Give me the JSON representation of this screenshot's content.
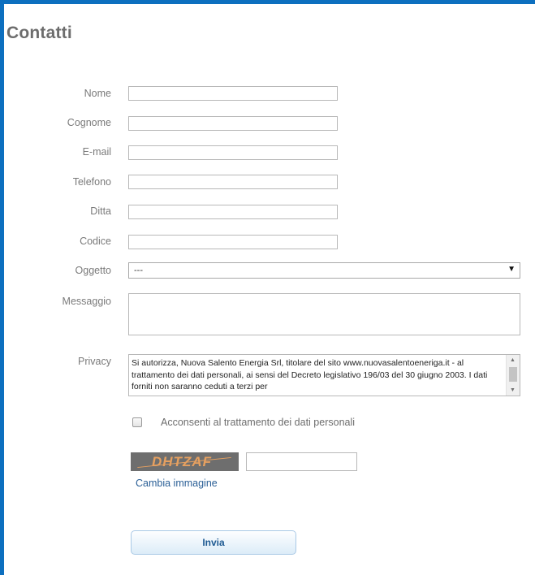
{
  "page": {
    "title": "Contatti"
  },
  "form": {
    "fields": [
      {
        "label": "Nome",
        "value": ""
      },
      {
        "label": "Cognome",
        "value": ""
      },
      {
        "label": "E-mail",
        "value": ""
      },
      {
        "label": "Telefono",
        "value": ""
      },
      {
        "label": "Ditta",
        "value": ""
      },
      {
        "label": "Codice",
        "value": ""
      }
    ],
    "oggetto": {
      "label": "Oggetto",
      "selected": "---"
    },
    "messaggio": {
      "label": "Messaggio",
      "value": ""
    },
    "privacy": {
      "label": "Privacy",
      "text": "Si autorizza, Nuova Salento Energia Srl, titolare del sito www.nuovasalentoeneriga.it - al trattamento dei dati personali, ai sensi del Decreto legislativo 196/03 del 30 giugno 2003. I dati forniti non saranno ceduti a terzi per"
    },
    "consent": {
      "label": "Acconsenti al trattamento dei dati personali",
      "checked": false
    },
    "captcha": {
      "image_text": "DHTZAF",
      "change_label": "Cambia immagine",
      "value": ""
    },
    "submit_label": "Invia"
  },
  "colors": {
    "accent": "#0d6fbf",
    "link": "#2a5f96"
  }
}
